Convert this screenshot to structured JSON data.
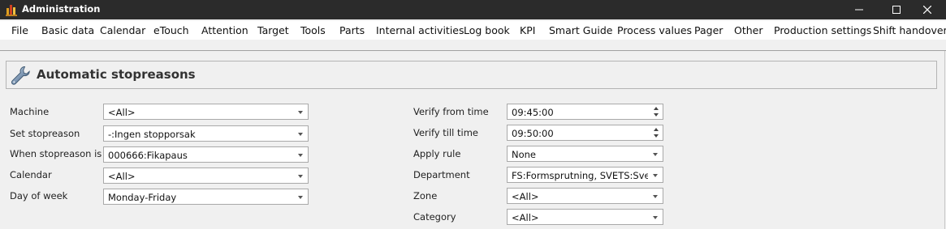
{
  "window": {
    "title": "Administration",
    "controls": {
      "minimize": "—",
      "maximize": "☐",
      "close": "✕"
    }
  },
  "menu": [
    "File",
    "Basic data",
    "Calendar",
    "eTouch",
    "Attention",
    "Target",
    "Tools",
    "Parts",
    "Internal activities",
    "Log book",
    "KPI",
    "Smart Guide",
    "Process values",
    "Pager",
    "Other",
    "Production settings",
    "Shift handover"
  ],
  "header": {
    "title": "Automatic stopreasons",
    "icon": "wrench-icon"
  },
  "form_left": [
    {
      "label": "Machine",
      "value": "<All>"
    },
    {
      "label": "Set stopreason",
      "value": "-:Ingen stopporsak"
    },
    {
      "label": "When stopreason is",
      "value": "000666:Fikapaus"
    },
    {
      "label": "Calendar",
      "value": "<All>"
    },
    {
      "label": "Day of week",
      "value": "Monday-Friday"
    }
  ],
  "form_right": [
    {
      "label": "Verify from time",
      "value": "09:45:00",
      "kind": "spinner"
    },
    {
      "label": "Verify till time",
      "value": "09:50:00",
      "kind": "spinner"
    },
    {
      "label": "Apply rule",
      "value": "None",
      "kind": "dropdown"
    },
    {
      "label": "Department",
      "value": "FS:Formsprutning, SVETS:Svets...",
      "kind": "dropdown"
    },
    {
      "label": "Zone",
      "value": "<All>",
      "kind": "dropdown"
    },
    {
      "label": "Category",
      "value": "<All>",
      "kind": "dropdown"
    }
  ],
  "colors": {
    "titlebar": "#2b2b2b",
    "menubar": "#ffffff",
    "background": "#f0f0f0"
  }
}
